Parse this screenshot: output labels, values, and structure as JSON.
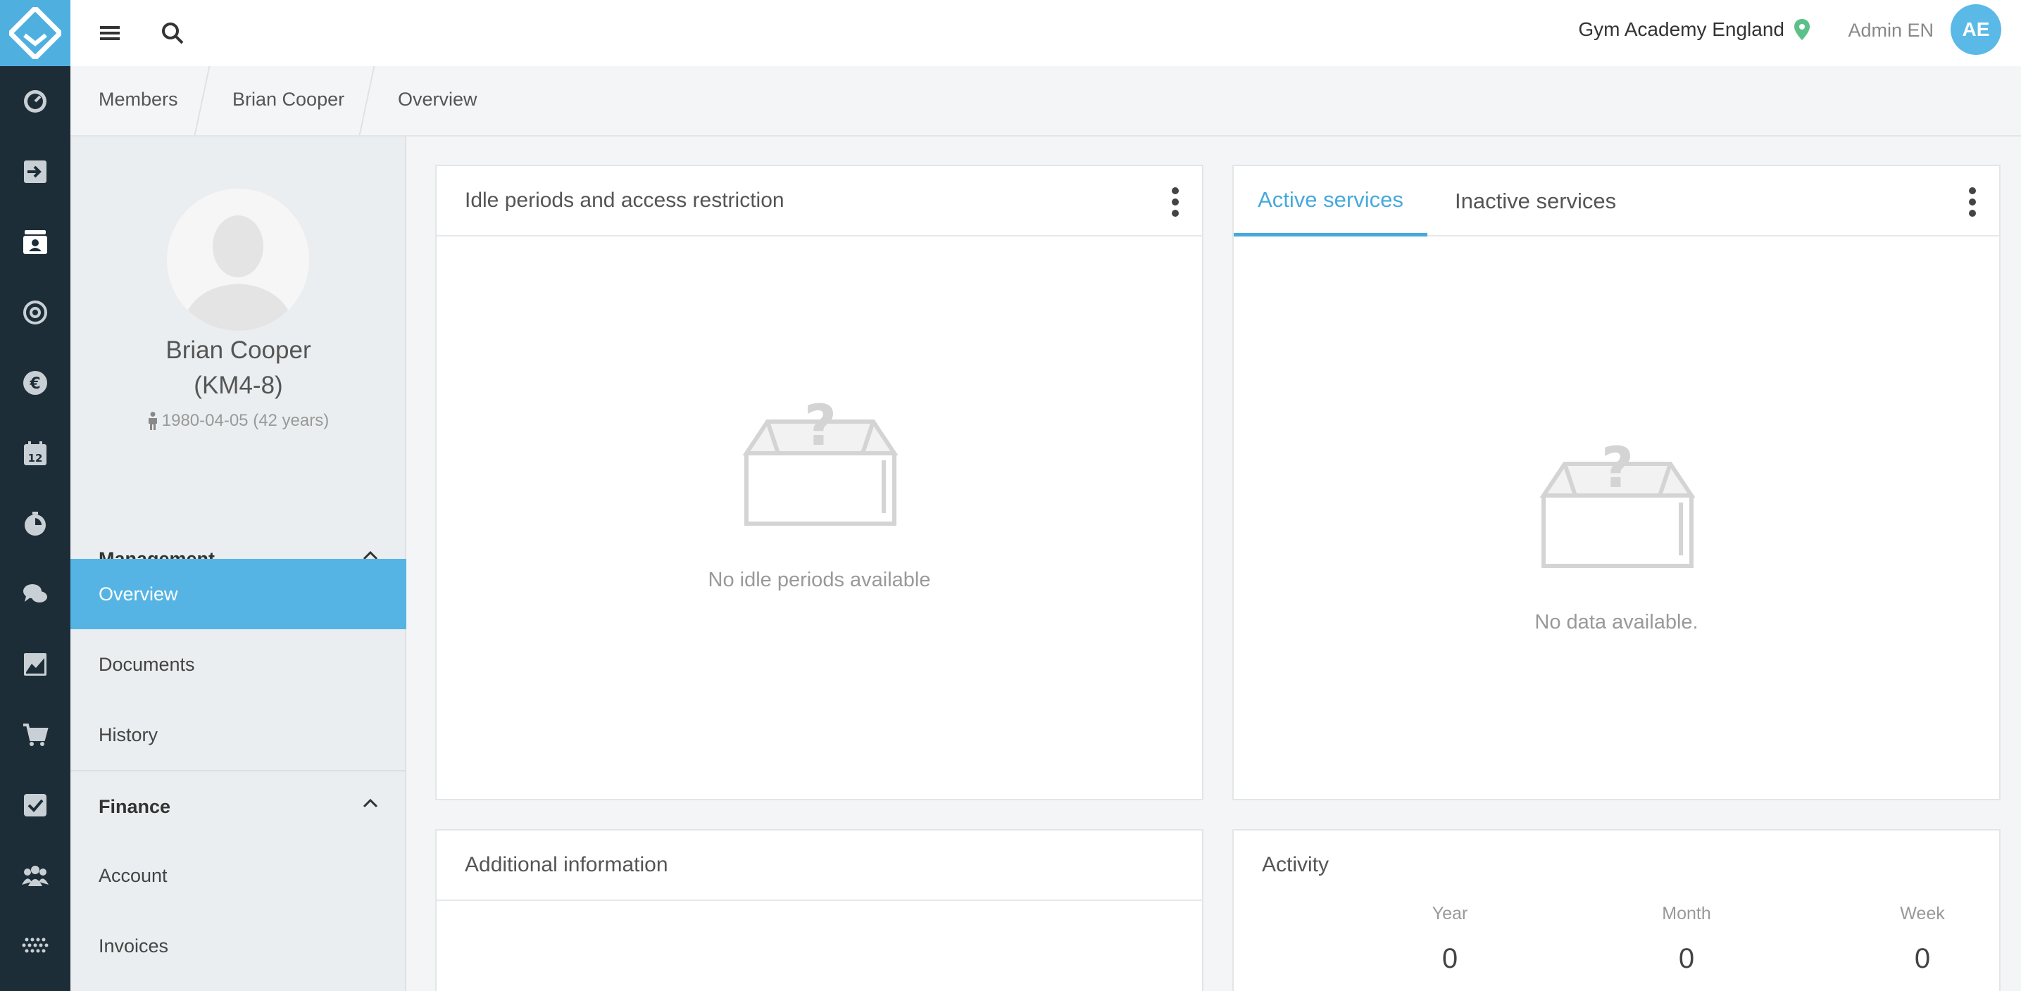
{
  "topbar": {
    "location": "Gym Academy England",
    "user": "Admin EN",
    "avatar_initials": "AE"
  },
  "breadcrumb": [
    "Members",
    "Brian Cooper",
    "Overview"
  ],
  "member": {
    "name": "Brian Cooper",
    "code": "(KM4-8)",
    "dob": "1980-04-05 (42 years)"
  },
  "sidenav": {
    "management": {
      "title": "Management",
      "items": [
        "Overview",
        "Documents",
        "History"
      ]
    },
    "finance": {
      "title": "Finance",
      "items": [
        "Account",
        "Invoices"
      ]
    }
  },
  "idle_card": {
    "title": "Idle periods and access restriction",
    "empty": "No idle periods available"
  },
  "services_card": {
    "tabs": [
      "Active services",
      "Inactive services"
    ],
    "empty": "No data available."
  },
  "additional_card": {
    "title": "Additional information"
  },
  "activity_card": {
    "title": "Activity",
    "stats": [
      {
        "label": "Year",
        "value": "0"
      },
      {
        "label": "Month",
        "value": "0"
      },
      {
        "label": "Week",
        "value": "0"
      }
    ]
  },
  "colors": {
    "accent": "#55b4e3",
    "rail": "#1d2d38",
    "location_pin": "#5cc189"
  }
}
